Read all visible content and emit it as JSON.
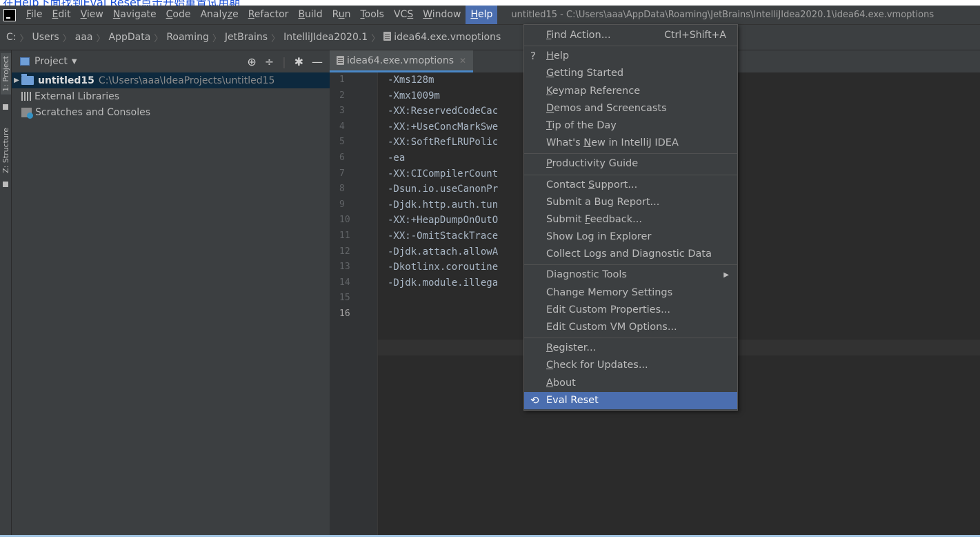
{
  "top_overlay": "在Help下面找到Eval Reset点击开始重置试用期",
  "menubar": {
    "items": [
      {
        "pre": "",
        "u": "F",
        "post": "ile"
      },
      {
        "pre": "",
        "u": "E",
        "post": "dit"
      },
      {
        "pre": "",
        "u": "V",
        "post": "iew"
      },
      {
        "pre": "",
        "u": "N",
        "post": "avigate"
      },
      {
        "pre": "",
        "u": "C",
        "post": "ode"
      },
      {
        "pre": "Analy",
        "u": "z",
        "post": "e"
      },
      {
        "pre": "",
        "u": "R",
        "post": "efactor"
      },
      {
        "pre": "",
        "u": "B",
        "post": "uild"
      },
      {
        "pre": "R",
        "u": "u",
        "post": "n"
      },
      {
        "pre": "",
        "u": "T",
        "post": "ools"
      },
      {
        "pre": "VC",
        "u": "S",
        "post": ""
      },
      {
        "pre": "",
        "u": "W",
        "post": "indow"
      },
      {
        "pre": "",
        "u": "H",
        "post": "elp"
      }
    ],
    "window_title": "untitled15 - C:\\Users\\aaa\\AppData\\Roaming\\JetBrains\\IntelliJIdea2020.1\\idea64.exe.vmoptions"
  },
  "breadcrumb": {
    "items": [
      "C:",
      "Users",
      "aaa",
      "AppData",
      "Roaming",
      "JetBrains",
      "IntelliJIdea2020.1",
      "idea64.exe.vmoptions"
    ]
  },
  "toolstrip": {
    "project": "1: Project",
    "structure": "Z: Structure"
  },
  "project_panel": {
    "title": "Project",
    "tree": {
      "root_name": "untitled15",
      "root_path": "C:\\Users\\aaa\\IdeaProjects\\untitled15",
      "external_libraries": "External Libraries",
      "scratches": "Scratches and Consoles"
    }
  },
  "editor": {
    "tab_label": "idea64.exe.vmoptions",
    "line_numbers": [
      "1",
      "2",
      "3",
      "4",
      "5",
      "6",
      "7",
      "8",
      "9",
      "10",
      "11",
      "12",
      "13",
      "14",
      "15",
      "16"
    ],
    "lines": [
      "-Xms128m",
      "-Xmx1009m",
      "-XX:ReservedCodeCac",
      "-XX:+UseConcMarkSwe",
      "-XX:SoftRefLRUPolic",
      "-ea",
      "-XX:CICompilerCount",
      "-Dsun.io.useCanonPr",
      "-Djdk.http.auth.tun",
      "-XX:+HeapDumpOnOutO",
      "-XX:-OmitStackTrace",
      "-Djdk.attach.allowA",
      "-Dkotlinx.coroutine",
      "-Djdk.module.illega",
      "",
      ""
    ]
  },
  "help_menu": {
    "find_action": {
      "pre": "",
      "u": "F",
      "post": "ind Action...",
      "shortcut": "Ctrl+Shift+A"
    },
    "help": {
      "lead": "?",
      "pre": "",
      "u": "H",
      "post": "elp"
    },
    "getting_started": {
      "pre": "",
      "u": "G",
      "post": "etting Started"
    },
    "keymap_reference": {
      "pre": "",
      "u": "K",
      "post": "eymap Reference"
    },
    "demos": {
      "pre": "",
      "u": "D",
      "post": "emos and Screencasts"
    },
    "tip_of_day": {
      "pre": "",
      "u": "T",
      "post": "ip of the Day"
    },
    "whats_new": {
      "pre": "What's ",
      "u": "N",
      "post": "ew in IntelliJ IDEA"
    },
    "productivity_guide": {
      "pre": "",
      "u": "P",
      "post": "roductivity Guide"
    },
    "contact_support": {
      "pre": "Contact ",
      "u": "S",
      "post": "upport..."
    },
    "submit_bug": {
      "pre": "Submit a Bug Report...",
      "u": "",
      "post": ""
    },
    "submit_feedback": {
      "pre": "Submit ",
      "u": "F",
      "post": "eedback..."
    },
    "show_log": {
      "pre": "Show Log in Explorer",
      "u": "",
      "post": ""
    },
    "collect_logs": {
      "pre": "Collect Logs and Diagnostic Data",
      "u": "",
      "post": ""
    },
    "diagnostic_tools": {
      "pre": "Diagnostic Tools",
      "u": "",
      "post": "",
      "submenu": "▶"
    },
    "change_memory": {
      "pre": "Change Memory Settings",
      "u": "",
      "post": ""
    },
    "edit_props": {
      "pre": "Edit Custom Properties...",
      "u": "",
      "post": ""
    },
    "edit_vm": {
      "pre": "Edit Custom VM Options...",
      "u": "",
      "post": ""
    },
    "register": {
      "pre": "",
      "u": "R",
      "post": "egister..."
    },
    "check_updates": {
      "pre": "",
      "u": "C",
      "post": "heck for Updates..."
    },
    "about": {
      "pre": "",
      "u": "A",
      "post": "bout"
    },
    "eval_reset": {
      "lead": "⟲",
      "pre": "Eval Reset",
      "u": "",
      "post": ""
    }
  }
}
